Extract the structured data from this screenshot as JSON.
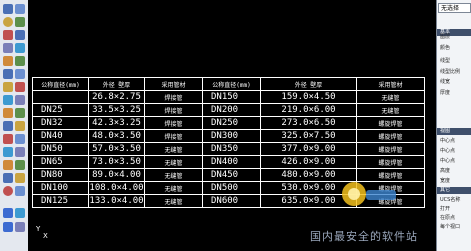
{
  "table": {
    "header": [
      "公称直径(mm)",
      "外径 壁厚",
      "采用管材",
      "公称直径(mm)",
      "外径 壁厚",
      "采用管材"
    ],
    "rows": [
      [
        "",
        "26.8×2.75",
        "焊接管",
        "DN150",
        "159.0×4.50",
        "无缝管"
      ],
      [
        "DN25",
        "33.5×3.25",
        "焊接管",
        "DN200",
        "219.0×6.00",
        "无缝管"
      ],
      [
        "DN32",
        "42.3×3.25",
        "焊接管",
        "DN250",
        "273.0×6.50",
        "螺旋焊管"
      ],
      [
        "DN40",
        "48.0×3.50",
        "焊接管",
        "DN300",
        "325.0×7.50",
        "螺旋焊管"
      ],
      [
        "DN50",
        "57.0×3.50",
        "无缝管",
        "DN350",
        "377.0×9.00",
        "螺旋焊管"
      ],
      [
        "DN65",
        "73.0×3.50",
        "无缝管",
        "DN400",
        "426.0×9.00",
        "螺旋焊管"
      ],
      [
        "DN80",
        "89.0×4.00",
        "无缝管",
        "DN450",
        "480.0×9.00",
        "螺旋焊管"
      ],
      [
        "DN100",
        "108.0×4.00",
        "无缝管",
        "DN500",
        "530.0×9.00",
        "螺旋焊管"
      ],
      [
        "DN125",
        "133.0×4.00",
        "无缝管",
        "DN600",
        "635.0×9.00",
        "螺旋焊管"
      ]
    ]
  },
  "properties": {
    "selector": "无选择",
    "section_basic": "基本",
    "items": [
      "颜色",
      "图层",
      "线型",
      "线型比例",
      "线宽",
      "厚度"
    ],
    "section_view": "视图",
    "view_items": [
      "中心点",
      "中心点",
      "中心点",
      "高度",
      "宽度"
    ],
    "section_misc": "其它",
    "misc_items": [
      "UCS名称",
      "打开",
      "在原点",
      "每个视口"
    ]
  },
  "ucs": {
    "y": "Y",
    "x": "X"
  },
  "watermark": "国内最安全的软件站",
  "colors": {
    "canvas": "#000000",
    "lines": "#ffffff",
    "panel_header": "#3f4f6b"
  }
}
